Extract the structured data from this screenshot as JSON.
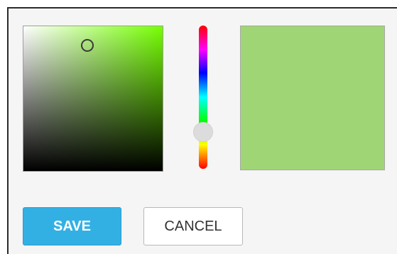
{
  "picker": {
    "hue_degrees": 92,
    "saturation": 0.46,
    "value": 0.87,
    "selected_color": "#9fd574",
    "base_hue_color": "#76ff03"
  },
  "buttons": {
    "save_label": "SAVE",
    "cancel_label": "CANCEL"
  },
  "colors": {
    "save_bg": "#33b0e3",
    "dialog_bg": "#f5f5f5"
  }
}
